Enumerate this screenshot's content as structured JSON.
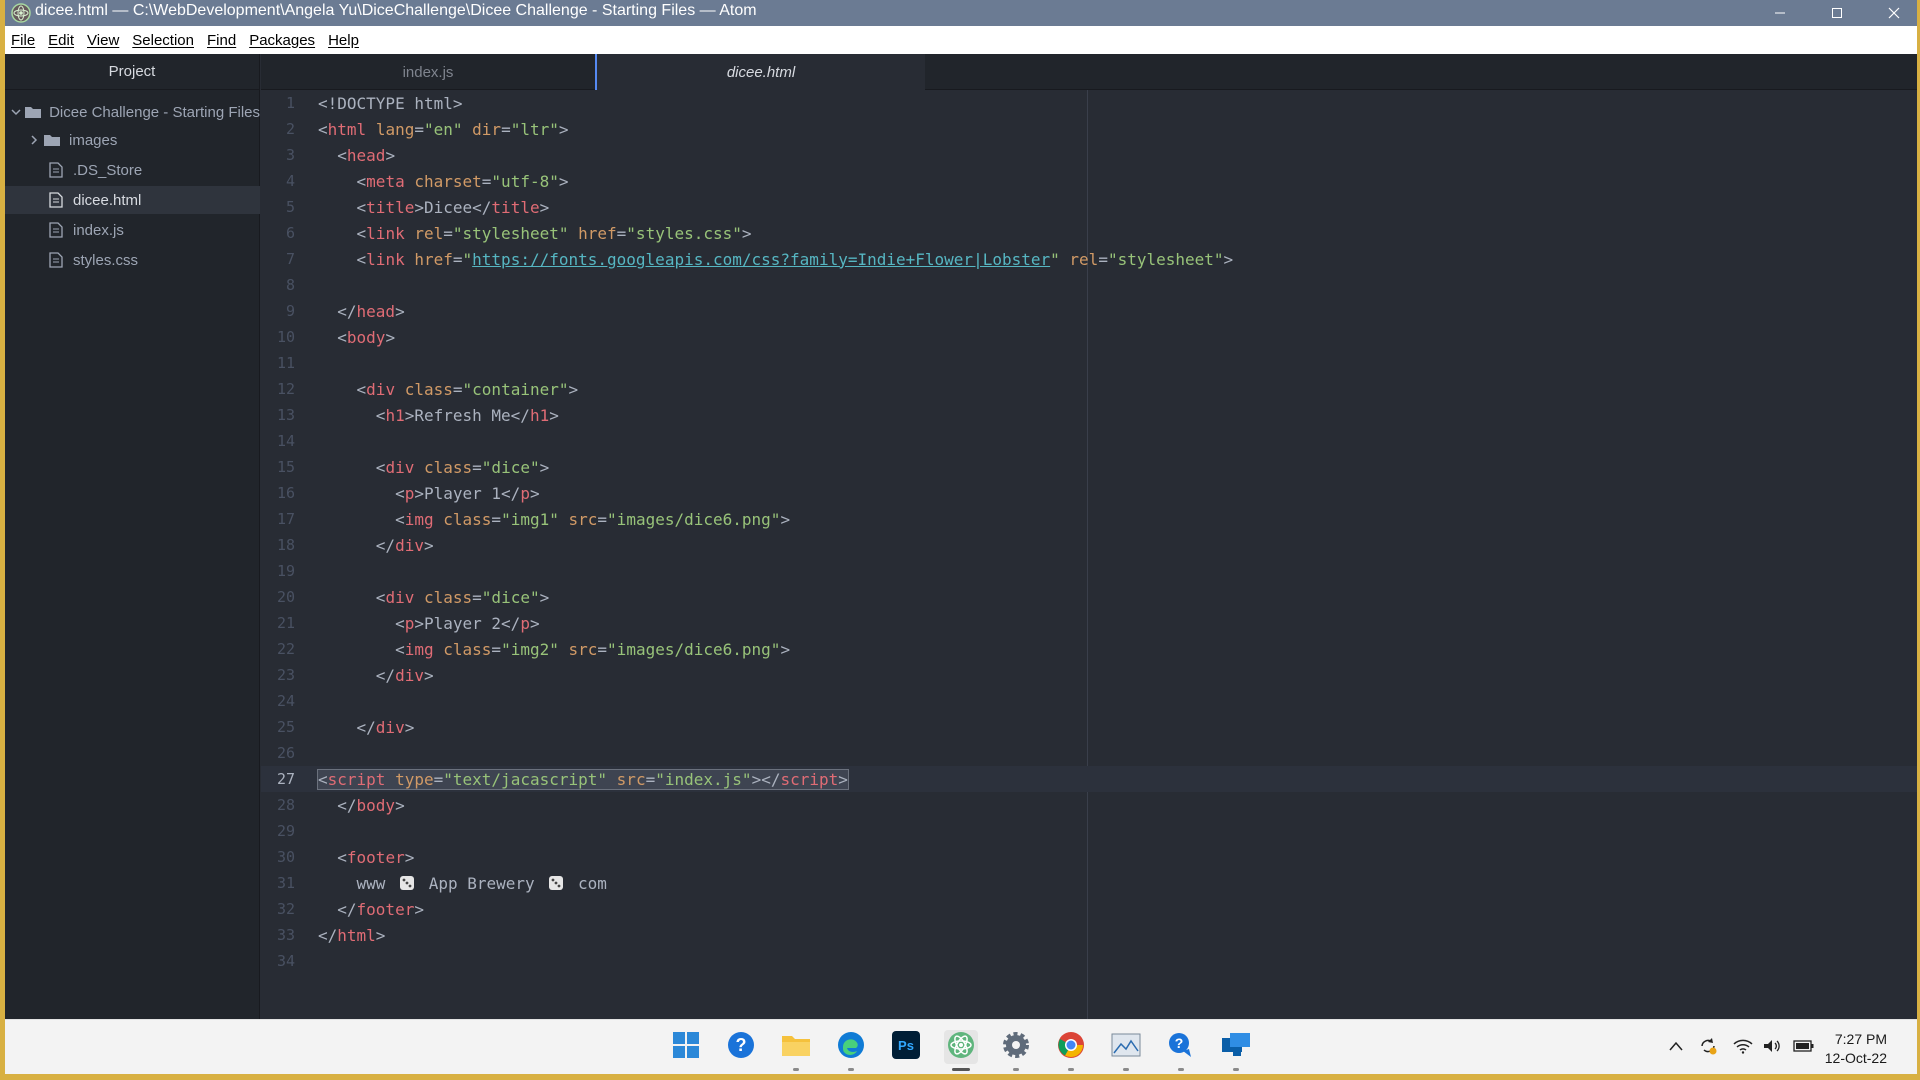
{
  "window": {
    "title": "dicee.html — C:\\WebDevelopment\\Angela Yu\\DiceChallenge\\Dicee Challenge - Starting Files — Atom"
  },
  "menu": [
    "File",
    "Edit",
    "View",
    "Selection",
    "Find",
    "Packages",
    "Help"
  ],
  "sidebar": {
    "header": "Project",
    "root": "Dicee Challenge - Starting Files",
    "items": [
      {
        "label": "images",
        "type": "folder"
      },
      {
        "label": ".DS_Store",
        "type": "file"
      },
      {
        "label": "dicee.html",
        "type": "file",
        "selected": true
      },
      {
        "label": "index.js",
        "type": "file"
      },
      {
        "label": "styles.css",
        "type": "file"
      }
    ]
  },
  "tabs": [
    {
      "label": "index.js",
      "active": false
    },
    {
      "label": "dicee.html",
      "active": true
    }
  ],
  "editor": {
    "cursor_line": 27,
    "line_numbers": [
      "1",
      "2",
      "3",
      "4",
      "5",
      "6",
      "7",
      "8",
      "9",
      "10",
      "11",
      "12",
      "13",
      "14",
      "15",
      "16",
      "17",
      "18",
      "19",
      "20",
      "21",
      "22",
      "23",
      "24",
      "25",
      "26",
      "27",
      "28",
      "29",
      "30",
      "31",
      "32",
      "33",
      "34"
    ],
    "code": {
      "l1": "<!DOCTYPE html>",
      "l7_url": "https://fonts.googleapis.com/css?family=Indie+Flower|Lobster",
      "l9": "</head>",
      "l13_text": "Refresh Me",
      "l16_text": "Player 1",
      "l21_text": "Player 2",
      "l27_src": "index.js",
      "l27_type": "text/jacascript",
      "l31_a": "www",
      "l31_b": "App Brewery",
      "l31_c": "com"
    }
  },
  "taskbar": {
    "apps": [
      "start-icon",
      "help-icon",
      "file-explorer-icon",
      "edge-icon",
      "photoshop-icon",
      "atom-icon",
      "settings-icon",
      "chrome-icon",
      "photos-icon",
      "get-help-icon",
      "remote-desktop-icon"
    ],
    "time": "7:27 PM",
    "date": "12-Oct-22"
  },
  "colors": {
    "title_bar": "#6b7b93",
    "editor_bg": "#282c34",
    "sidebar_bg": "#21252b",
    "tag": "#e06c75",
    "attr": "#d19a66",
    "string": "#98c379",
    "url": "#56b6c2"
  }
}
